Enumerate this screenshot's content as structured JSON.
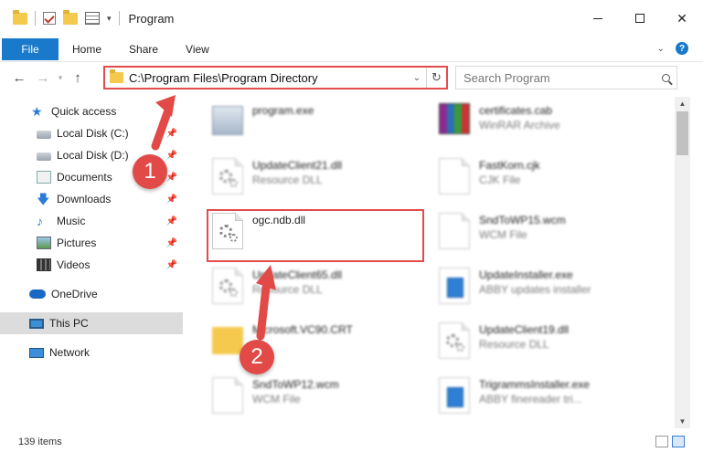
{
  "window": {
    "title": "Program"
  },
  "ribbon": {
    "tabs": [
      "File",
      "Home",
      "Share",
      "View"
    ],
    "help": "?"
  },
  "address": {
    "path": "C:\\Program Files\\Program Directory"
  },
  "search": {
    "placeholder": "Search Program"
  },
  "sidebar": {
    "items": [
      {
        "label": "Quick access",
        "icon": "star-icon"
      },
      {
        "label": "Local Disk (C:)",
        "icon": "drive-icon"
      },
      {
        "label": "Local Disk (D:)",
        "icon": "drive-icon"
      },
      {
        "label": "Documents",
        "icon": "documents-icon"
      },
      {
        "label": "Downloads",
        "icon": "downloads-icon"
      },
      {
        "label": "Music",
        "icon": "music-icon"
      },
      {
        "label": "Pictures",
        "icon": "pictures-icon"
      },
      {
        "label": "Videos",
        "icon": "videos-icon"
      },
      {
        "label": "OneDrive",
        "icon": "cloud-icon"
      },
      {
        "label": "This PC",
        "icon": "computer-icon"
      },
      {
        "label": "Network",
        "icon": "network-icon"
      }
    ]
  },
  "files": [
    {
      "name": "program.exe",
      "type": ""
    },
    {
      "name": "certificates.cab",
      "type": "WinRAR Archive"
    },
    {
      "name": "UpdateClient21.dll",
      "type": "Resource DLL"
    },
    {
      "name": "FastKorn.cjk",
      "type": "CJK File"
    },
    {
      "name": "ogc.ndb.dll",
      "type": ""
    },
    {
      "name": "SndToWP15.wcm",
      "type": "WCM File"
    },
    {
      "name": "UpdateClient65.dll",
      "type": "Resource DLL"
    },
    {
      "name": "UpdateInstaller.exe",
      "type": "ABBY updates installer"
    },
    {
      "name": "Microsoft.VC90.CRT",
      "type": ""
    },
    {
      "name": "UpdateClient19.dll",
      "type": "Resource DLL"
    },
    {
      "name": "SndToWP12.wcm",
      "type": "WCM File"
    },
    {
      "name": "TrigrammsInstaller.exe",
      "type": "ABBY finereader tri..."
    }
  ],
  "status": {
    "count": "139 items"
  },
  "callouts": {
    "one": "1",
    "two": "2"
  },
  "colors": {
    "accent": "#1979ca",
    "highlight": "#e34c4c"
  }
}
